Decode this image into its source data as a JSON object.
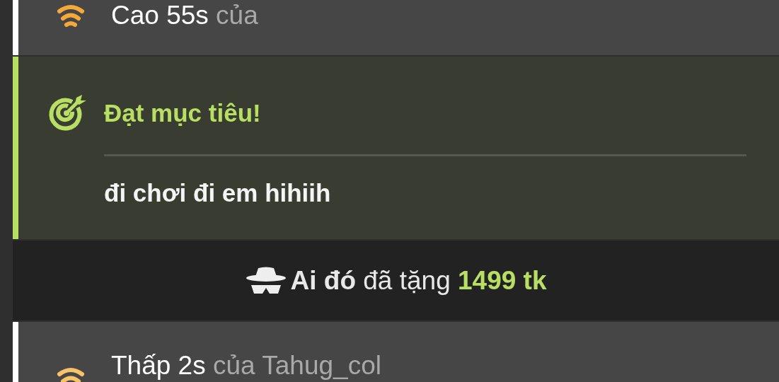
{
  "feed": [
    {
      "kind": "tier",
      "color": "#f5a93b",
      "main": "Cao 55s",
      "sub": "của"
    },
    {
      "kind": "goal",
      "title": "Đạt mục tiêu!",
      "message": "đi chơi đi em hihiih"
    },
    {
      "kind": "banner",
      "text": "**Ai đó** đã tặng **1499 tk**"
    },
    {
      "kind": "tier",
      "color": "#f6c466",
      "main": "Thấp 2s",
      "sub": "của Tahug_col"
    }
  ]
}
